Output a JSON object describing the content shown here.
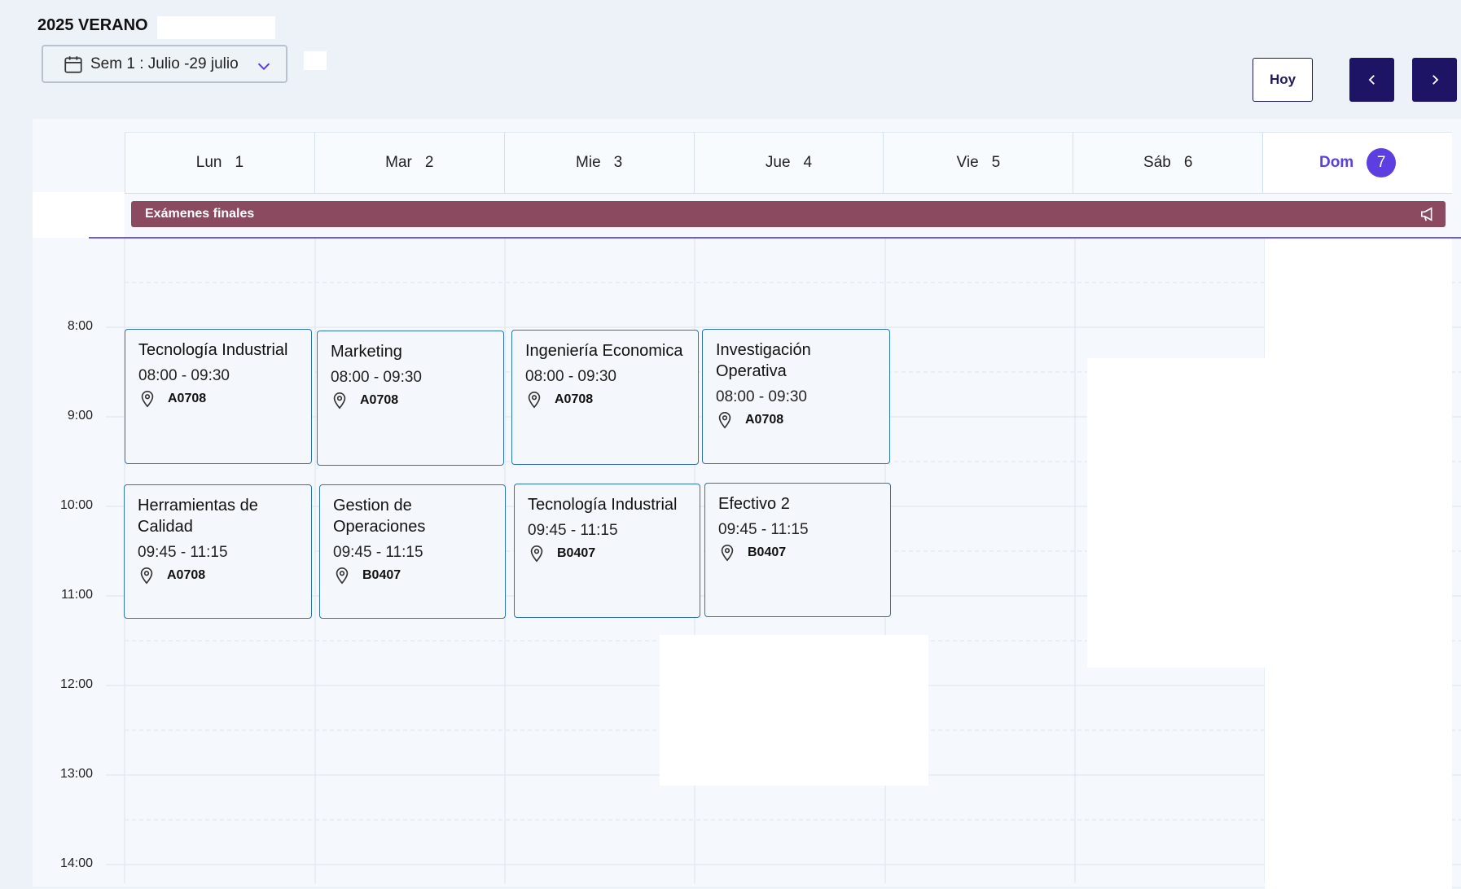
{
  "term": {
    "title": "2025 VERANO"
  },
  "week_select": {
    "label": "Sem 1 : Julio -29 julio",
    "icon": "calendar-icon",
    "chevron": "chevron-down-icon"
  },
  "toolbar": {
    "today_label": "Hoy",
    "prev_icon": "chevron-left-icon",
    "next_icon": "chevron-right-icon"
  },
  "days": [
    {
      "name": "Lun",
      "num": "1"
    },
    {
      "name": "Mar",
      "num": "2"
    },
    {
      "name": "Mie",
      "num": "3"
    },
    {
      "name": "Jue",
      "num": "4"
    },
    {
      "name": "Vie",
      "num": "5"
    },
    {
      "name": "Sáb",
      "num": "6"
    },
    {
      "name": "Dom",
      "num": "7",
      "today": true
    }
  ],
  "allday_banner": {
    "label": "Exámenes finales",
    "icon": "megaphone-icon",
    "color": "#8c4a60"
  },
  "hours": [
    "8:00",
    "9:00",
    "10:00",
    "11:00",
    "12:00",
    "13:00",
    "14:00"
  ],
  "events": [
    {
      "title": "Tecnología Industrial",
      "time": "08:00 - 09:30",
      "room": "A0708"
    },
    {
      "title": "Marketing",
      "time": "08:00 - 09:30",
      "room": "A0708"
    },
    {
      "title": "Ingeniería Economica",
      "time": "08:00 - 09:30",
      "room": "A0708"
    },
    {
      "title": "Investigación Operativa",
      "time": "08:00 - 09:30",
      "room": "A0708"
    },
    {
      "title": "Herramientas de Calidad",
      "time": "09:45 - 11:15",
      "room": "A0708"
    },
    {
      "title": "Gestion de Operaciones",
      "time": "09:45 - 11:15",
      "room": "B0407"
    },
    {
      "title": "Tecnología Industrial",
      "time": "09:45 - 11:15",
      "room": "B0407"
    },
    {
      "title": "Efectivo 2",
      "time": "09:45 - 11:15",
      "room": "B0407"
    }
  ],
  "colors": {
    "accent": "#5b3fe0",
    "event_border": "#2f72b8",
    "nav_button": "#1e1466"
  }
}
